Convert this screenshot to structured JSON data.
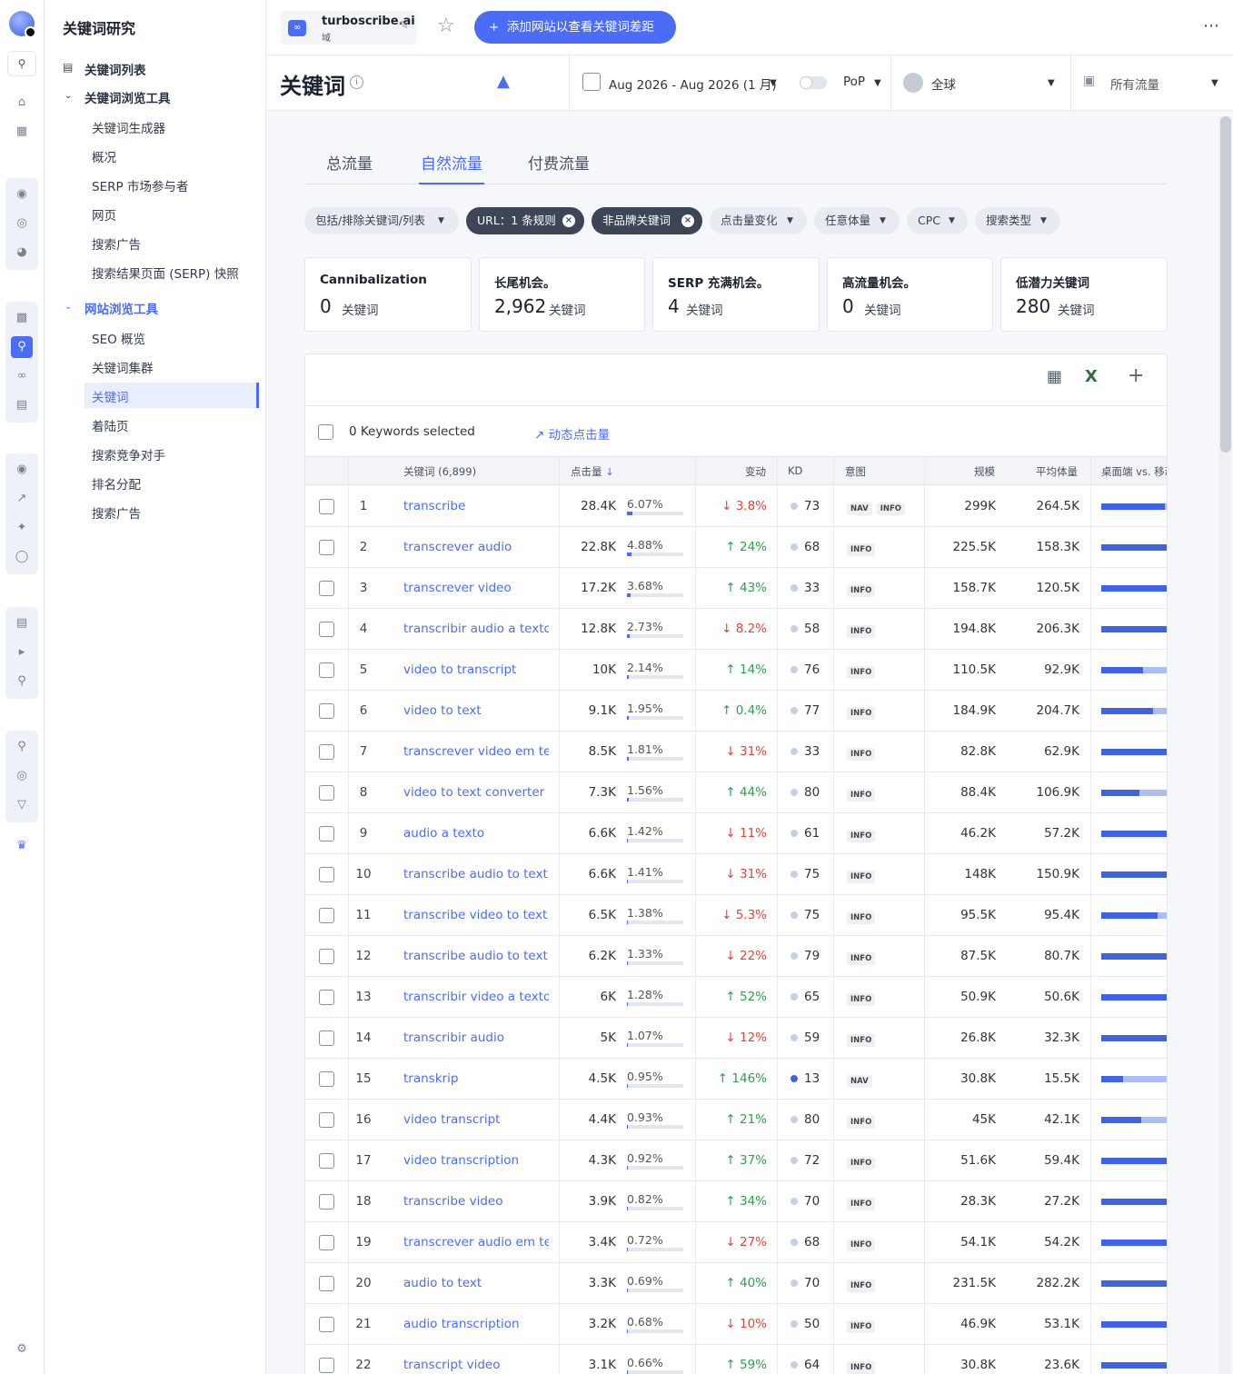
{
  "brand_colors": {
    "accent": "#4a6cf7",
    "up": "#2d9f4f",
    "down": "#e0453a"
  },
  "rail_icons": [
    "logo-icon",
    "search-icon",
    "home-icon",
    "apps-icon",
    "globe-icon",
    "world-icon",
    "pie-icon",
    "chart-icon",
    "keyword-search-icon",
    "link-icon",
    "audit-icon",
    "eye-icon",
    "trend-icon",
    "sparkle-icon",
    "bulb-icon",
    "report-icon",
    "megaphone-icon",
    "magnify-icon",
    "zoom-icon",
    "scan-icon",
    "filter-icon",
    "crown-icon",
    "settings-icon"
  ],
  "nav": {
    "title": "关键词研究",
    "items": [
      {
        "label": "关键词列表"
      },
      {
        "label": "关键词浏览工具"
      },
      {
        "label": "关键词生成器"
      },
      {
        "label": "概况"
      },
      {
        "label": "SERP 市场参与者"
      },
      {
        "label": "网页"
      },
      {
        "label": "搜索广告"
      },
      {
        "label": "搜索结果页面 (SERP) 快照"
      },
      {
        "label": "网站浏览工具"
      },
      {
        "label": "SEO 概览"
      },
      {
        "label": "关键词集群"
      },
      {
        "label": "关键词"
      },
      {
        "label": "着陆页"
      },
      {
        "label": "搜索竞争对手"
      },
      {
        "label": "排名分配"
      },
      {
        "label": "搜索广告"
      }
    ]
  },
  "header": {
    "site_name": "turboscribe.ai",
    "site_type": "域",
    "add_button": "添加网站以查看关键词差距"
  },
  "toolbar": {
    "page_title": "关键词",
    "date_range": "Aug 2026 - Aug 2026 (1 月)",
    "compare": "PoP",
    "region": "全球",
    "traffic": "所有流量"
  },
  "tabs": [
    "总流量",
    "自然流量",
    "付费流量"
  ],
  "active_tab": 1,
  "filters": [
    "包括/排除关键词/列表",
    "URL：1 条规则",
    "非品牌关键词",
    "点击量变化",
    "任意体量",
    "CPC",
    "搜索类型"
  ],
  "cards": [
    {
      "title": "Cannibalization",
      "value": "0",
      "unit": "关键词"
    },
    {
      "title": "长尾机会。",
      "value": "2,962",
      "unit": "关键词"
    },
    {
      "title": "SERP 充满机会。",
      "value": "4",
      "unit": "关键词"
    },
    {
      "title": "高流量机会。",
      "value": "0",
      "unit": "关键词"
    },
    {
      "title": "低潜力关键词",
      "value": "280",
      "unit": "关键词"
    }
  ],
  "table": {
    "selected_text": "0 Keywords selected",
    "dynamic_clicks": "动态点击量",
    "headers": {
      "keyword": "关键词 (6,899)",
      "clicks": "点击量",
      "change": "变动",
      "kd": "KD",
      "intent": "意图",
      "volume": "规模",
      "avg_volume": "平均体量",
      "device": "桌面端 vs. 移动"
    },
    "rows": [
      {
        "n": "1",
        "kw": "transcribe",
        "clicks": "28.4K",
        "pct": "6.07%",
        "share": 0.0607,
        "dir": "down",
        "chg": "3.8%",
        "kd": "73",
        "intent": [
          "NAV",
          "INFO"
        ],
        "vol": "299K",
        "avg": "264.5K",
        "desktop": 0.95,
        "kd_dark": false
      },
      {
        "n": "2",
        "kw": "transcrever audio",
        "clicks": "22.8K",
        "pct": "4.88%",
        "share": 0.0488,
        "dir": "up",
        "chg": "24%",
        "kd": "68",
        "intent": [
          "INFO"
        ],
        "vol": "225.5K",
        "avg": "158.3K",
        "desktop": 1.0,
        "kd_dark": false
      },
      {
        "n": "3",
        "kw": "transcrever video",
        "clicks": "17.2K",
        "pct": "3.68%",
        "share": 0.0368,
        "dir": "up",
        "chg": "43%",
        "kd": "33",
        "intent": [
          "INFO"
        ],
        "vol": "158.7K",
        "avg": "120.5K",
        "desktop": 1.0,
        "kd_dark": false
      },
      {
        "n": "4",
        "kw": "transcribir audio a texto",
        "clicks": "12.8K",
        "pct": "2.73%",
        "share": 0.0273,
        "dir": "down",
        "chg": "8.2%",
        "kd": "58",
        "intent": [
          "INFO"
        ],
        "vol": "194.8K",
        "avg": "206.3K",
        "desktop": 1.0,
        "kd_dark": false
      },
      {
        "n": "5",
        "kw": "video to transcript",
        "clicks": "10K",
        "pct": "2.14%",
        "share": 0.0214,
        "dir": "up",
        "chg": "14%",
        "kd": "76",
        "intent": [
          "INFO"
        ],
        "vol": "110.5K",
        "avg": "92.9K",
        "desktop": 0.62,
        "kd_dark": false
      },
      {
        "n": "6",
        "kw": "video to text",
        "clicks": "9.1K",
        "pct": "1.95%",
        "share": 0.0195,
        "dir": "up",
        "chg": "0.4%",
        "kd": "77",
        "intent": [
          "INFO"
        ],
        "vol": "184.9K",
        "avg": "204.7K",
        "desktop": 0.77,
        "kd_dark": false
      },
      {
        "n": "7",
        "kw": "transcrever video em texto",
        "clicks": "8.5K",
        "pct": "1.81%",
        "share": 0.0181,
        "dir": "down",
        "chg": "31%",
        "kd": "33",
        "intent": [
          "INFO"
        ],
        "vol": "82.8K",
        "avg": "62.9K",
        "desktop": 1.0,
        "kd_dark": false
      },
      {
        "n": "8",
        "kw": "video to text converter",
        "clicks": "7.3K",
        "pct": "1.56%",
        "share": 0.0156,
        "dir": "up",
        "chg": "44%",
        "kd": "80",
        "intent": [
          "INFO"
        ],
        "vol": "88.4K",
        "avg": "106.9K",
        "desktop": 0.57,
        "kd_dark": false
      },
      {
        "n": "9",
        "kw": "audio a texto",
        "clicks": "6.6K",
        "pct": "1.42%",
        "share": 0.0142,
        "dir": "down",
        "chg": "11%",
        "kd": "61",
        "intent": [
          "INFO"
        ],
        "vol": "46.2K",
        "avg": "57.2K",
        "desktop": 1.0,
        "kd_dark": false
      },
      {
        "n": "10",
        "kw": "transcribe audio to text",
        "clicks": "6.6K",
        "pct": "1.41%",
        "share": 0.0141,
        "dir": "down",
        "chg": "31%",
        "kd": "75",
        "intent": [
          "INFO"
        ],
        "vol": "148K",
        "avg": "150.9K",
        "desktop": 1.0,
        "kd_dark": false
      },
      {
        "n": "11",
        "kw": "transcribe video to text",
        "clicks": "6.5K",
        "pct": "1.38%",
        "share": 0.0138,
        "dir": "down",
        "chg": "5.3%",
        "kd": "75",
        "intent": [
          "INFO"
        ],
        "vol": "95.5K",
        "avg": "95.4K",
        "desktop": 0.84,
        "kd_dark": false
      },
      {
        "n": "12",
        "kw": "transcribe audio to text free",
        "clicks": "6.2K",
        "pct": "1.33%",
        "share": 0.0133,
        "dir": "down",
        "chg": "22%",
        "kd": "79",
        "intent": [
          "INFO"
        ],
        "vol": "87.5K",
        "avg": "80.7K",
        "desktop": 1.0,
        "kd_dark": false
      },
      {
        "n": "13",
        "kw": "transcribir video a texto",
        "clicks": "6K",
        "pct": "1.28%",
        "share": 0.0128,
        "dir": "up",
        "chg": "52%",
        "kd": "65",
        "intent": [
          "INFO"
        ],
        "vol": "50.9K",
        "avg": "50.6K",
        "desktop": 1.0,
        "kd_dark": false
      },
      {
        "n": "14",
        "kw": "transcribir audio",
        "clicks": "5K",
        "pct": "1.07%",
        "share": 0.0107,
        "dir": "down",
        "chg": "12%",
        "kd": "59",
        "intent": [
          "INFO"
        ],
        "vol": "26.8K",
        "avg": "32.3K",
        "desktop": 1.0,
        "kd_dark": false
      },
      {
        "n": "15",
        "kw": "transkrip",
        "clicks": "4.5K",
        "pct": "0.95%",
        "share": 0.0095,
        "dir": "up",
        "chg": "146%",
        "kd": "13",
        "intent": [
          "NAV"
        ],
        "vol": "30.8K",
        "avg": "15.5K",
        "desktop": 0.32,
        "kd_dark": true
      },
      {
        "n": "16",
        "kw": "video transcript",
        "clicks": "4.4K",
        "pct": "0.93%",
        "share": 0.0093,
        "dir": "up",
        "chg": "21%",
        "kd": "80",
        "intent": [
          "INFO"
        ],
        "vol": "45K",
        "avg": "42.1K",
        "desktop": 0.6,
        "kd_dark": false
      },
      {
        "n": "17",
        "kw": "video transcription",
        "clicks": "4.3K",
        "pct": "0.92%",
        "share": 0.0092,
        "dir": "up",
        "chg": "37%",
        "kd": "72",
        "intent": [
          "INFO"
        ],
        "vol": "51.6K",
        "avg": "59.4K",
        "desktop": 1.0,
        "kd_dark": false
      },
      {
        "n": "18",
        "kw": "transcribe video",
        "clicks": "3.9K",
        "pct": "0.82%",
        "share": 0.0082,
        "dir": "up",
        "chg": "34%",
        "kd": "70",
        "intent": [
          "INFO"
        ],
        "vol": "28.3K",
        "avg": "27.2K",
        "desktop": 1.0,
        "kd_dark": false
      },
      {
        "n": "19",
        "kw": "transcrever audio em texto",
        "clicks": "3.4K",
        "pct": "0.72%",
        "share": 0.0072,
        "dir": "down",
        "chg": "27%",
        "kd": "68",
        "intent": [
          "INFO"
        ],
        "vol": "54.1K",
        "avg": "54.2K",
        "desktop": 1.0,
        "kd_dark": false
      },
      {
        "n": "20",
        "kw": "audio to text",
        "clicks": "3.3K",
        "pct": "0.69%",
        "share": 0.0069,
        "dir": "up",
        "chg": "40%",
        "kd": "70",
        "intent": [
          "INFO"
        ],
        "vol": "231.5K",
        "avg": "282.2K",
        "desktop": 1.0,
        "kd_dark": false
      },
      {
        "n": "21",
        "kw": "audio transcription",
        "clicks": "3.2K",
        "pct": "0.68%",
        "share": 0.0068,
        "dir": "down",
        "chg": "10%",
        "kd": "50",
        "intent": [
          "INFO"
        ],
        "vol": "46.9K",
        "avg": "53.1K",
        "desktop": 1.0,
        "kd_dark": false
      },
      {
        "n": "22",
        "kw": "transcript video",
        "clicks": "3.1K",
        "pct": "0.66%",
        "share": 0.0066,
        "dir": "up",
        "chg": "59%",
        "kd": "64",
        "intent": [
          "INFO"
        ],
        "vol": "30.8K",
        "avg": "23.6K",
        "desktop": 1.0,
        "kd_dark": false
      }
    ]
  }
}
